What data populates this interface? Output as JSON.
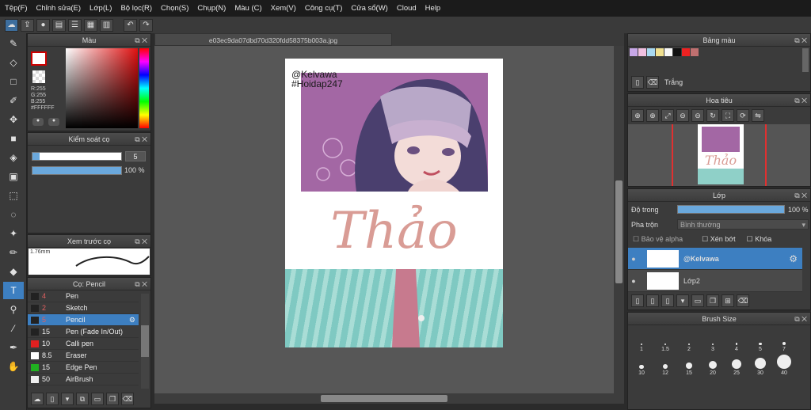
{
  "menu": [
    "Tệp(F)",
    "Chỉnh sửa(E)",
    "Lớp(L)",
    "Bộ lọc(R)",
    "Chọn(S)",
    "Chụp(N)",
    "Màu (C)",
    "Xem(V)",
    "Công cụ(T)",
    "Cửa sổ(W)",
    "Cloud",
    "Help"
  ],
  "doc": {
    "filename": "e03ec9da07dbd70d320fdd58375b003a.jpg"
  },
  "color_panel": {
    "title": "Màu",
    "r": "R:255",
    "g": "G:255",
    "b": "B:255",
    "hex": "#FFFFFF"
  },
  "brush_control": {
    "title": "Kiểm soát cọ",
    "size": "5",
    "opacity": "100 %",
    "opacity_value": 100
  },
  "brush_preview": {
    "title": "Xem trước cọ",
    "size": "1.76mm"
  },
  "brush_list": {
    "title": "Cọ: Pencil",
    "items": [
      {
        "num": "4",
        "name": "Pen",
        "color": "#222222"
      },
      {
        "num": "2",
        "name": "Sketch",
        "color": "#222222"
      },
      {
        "num": "5",
        "name": "Pencil",
        "color": "#222222",
        "selected": true
      },
      {
        "num": "15",
        "name": "Pen (Fade In/Out)",
        "color": "#222222"
      },
      {
        "num": "10",
        "name": "Calli pen",
        "color": "#e02020"
      },
      {
        "num": "8.5",
        "name": "Eraser",
        "color": "#ffffff"
      },
      {
        "num": "15",
        "name": "Edge Pen",
        "color": "#20b020"
      },
      {
        "num": "50",
        "name": "AirBrush",
        "color": "#eeeeee"
      }
    ]
  },
  "palette": {
    "title": "Bảng màu",
    "swatch_name": "Trắng",
    "colors": [
      "#c8a8e8",
      "#f0c0e0",
      "#a8d8f0",
      "#f0e090",
      "#f8f8f8",
      "#111111",
      "#ee2222",
      "#c07070"
    ]
  },
  "navigator": {
    "title": "Hoa tiêu"
  },
  "layers": {
    "title": "Lớp",
    "opacity_label": "Độ trong",
    "opacity": "100 %",
    "opacity_value": 100,
    "blend_label": "Pha trộn",
    "blend_value": "Bình thường",
    "protect_alpha": "Bảo vệ alpha",
    "clipping": "Xén bớt",
    "lock": "Khóa",
    "items": [
      {
        "name": "@Kelvawa",
        "selected": true
      },
      {
        "name": "Lớp2",
        "selected": false
      }
    ]
  },
  "brush_size": {
    "title": "Brush Size",
    "sizes": [
      "1",
      "1.5",
      "2",
      "3",
      "4",
      "5",
      "7",
      "10",
      "12",
      "15",
      "20",
      "25",
      "30",
      "40"
    ]
  },
  "artwork": {
    "watermark1": "@Kelvawa",
    "watermark2": "#Hoidap247",
    "title": "Thảo"
  }
}
